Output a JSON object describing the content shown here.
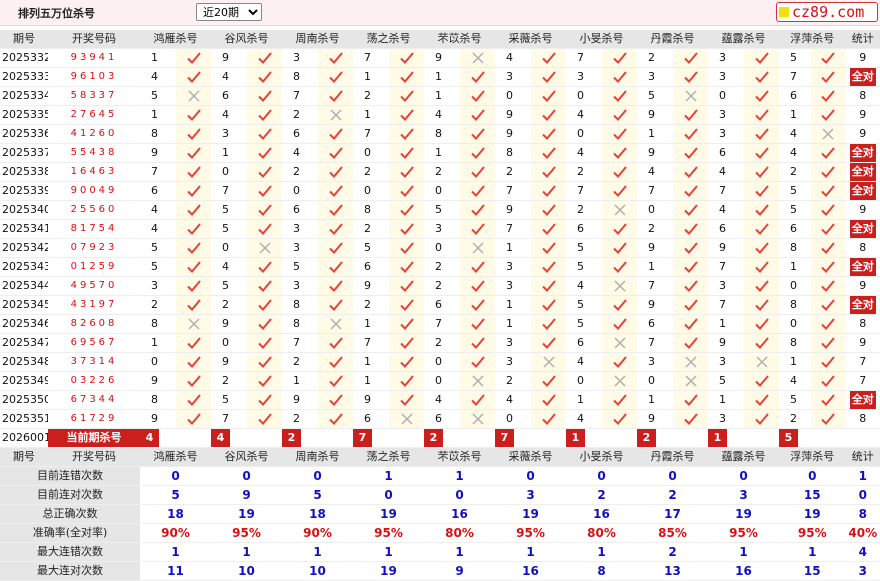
{
  "topbar": {
    "title": "排列五万位杀号",
    "period_options": [
      "近20期"
    ],
    "selected": "近20期",
    "logo": "cz89.com"
  },
  "headers": [
    "期号",
    "开奖号码",
    "鸿雁杀号",
    "谷风杀号",
    "周南杀号",
    "荡之杀号",
    "芣苡杀号",
    "采薇杀号",
    "小旻杀号",
    "丹霞杀号",
    "蕴露杀号",
    "浮萍杀号",
    "统计"
  ],
  "rows": [
    {
      "period": "2025332",
      "draw": "93941",
      "kills": [
        1,
        9,
        3,
        7,
        9,
        4,
        7,
        2,
        3,
        5
      ],
      "ok": [
        1,
        1,
        1,
        1,
        0,
        1,
        1,
        1,
        1,
        1
      ],
      "stat": "9"
    },
    {
      "period": "2025333",
      "draw": "96103",
      "kills": [
        4,
        4,
        8,
        1,
        1,
        3,
        3,
        3,
        3,
        7
      ],
      "ok": [
        1,
        1,
        1,
        1,
        1,
        1,
        1,
        1,
        1,
        1
      ],
      "stat": "全对"
    },
    {
      "period": "2025334",
      "draw": "58337",
      "kills": [
        5,
        6,
        7,
        2,
        1,
        0,
        0,
        5,
        0,
        6
      ],
      "ok": [
        0,
        1,
        1,
        1,
        1,
        1,
        1,
        0,
        1,
        1
      ],
      "stat": "8"
    },
    {
      "period": "2025335",
      "draw": "27645",
      "kills": [
        1,
        4,
        2,
        1,
        4,
        9,
        4,
        9,
        3,
        1
      ],
      "ok": [
        1,
        1,
        0,
        1,
        1,
        1,
        1,
        1,
        1,
        1
      ],
      "stat": "9"
    },
    {
      "period": "2025336",
      "draw": "41260",
      "kills": [
        8,
        3,
        6,
        7,
        8,
        9,
        0,
        1,
        3,
        4
      ],
      "ok": [
        1,
        1,
        1,
        1,
        1,
        1,
        1,
        1,
        1,
        0
      ],
      "stat": "9"
    },
    {
      "period": "2025337",
      "draw": "55438",
      "kills": [
        9,
        1,
        4,
        0,
        1,
        8,
        4,
        9,
        6,
        4
      ],
      "ok": [
        1,
        1,
        1,
        1,
        1,
        1,
        1,
        1,
        1,
        1
      ],
      "stat": "全对"
    },
    {
      "period": "2025338",
      "draw": "16463",
      "kills": [
        7,
        0,
        2,
        2,
        2,
        2,
        2,
        4,
        4,
        2
      ],
      "ok": [
        1,
        1,
        1,
        1,
        1,
        1,
        1,
        1,
        1,
        1
      ],
      "stat": "全对"
    },
    {
      "period": "2025339",
      "draw": "90049",
      "kills": [
        6,
        7,
        0,
        0,
        0,
        7,
        7,
        7,
        7,
        5
      ],
      "ok": [
        1,
        1,
        1,
        1,
        1,
        1,
        1,
        1,
        1,
        1
      ],
      "stat": "全对"
    },
    {
      "period": "2025340",
      "draw": "25560",
      "kills": [
        4,
        5,
        6,
        8,
        5,
        9,
        2,
        0,
        4,
        5
      ],
      "ok": [
        1,
        1,
        1,
        1,
        1,
        1,
        0,
        1,
        1,
        1
      ],
      "stat": "9"
    },
    {
      "period": "2025341",
      "draw": "81754",
      "kills": [
        4,
        5,
        3,
        2,
        3,
        7,
        6,
        2,
        6,
        6
      ],
      "ok": [
        1,
        1,
        1,
        1,
        1,
        1,
        1,
        1,
        1,
        1
      ],
      "stat": "全对"
    },
    {
      "period": "2025342",
      "draw": "07923",
      "kills": [
        5,
        0,
        3,
        5,
        0,
        1,
        5,
        9,
        9,
        8
      ],
      "ok": [
        1,
        0,
        1,
        1,
        0,
        1,
        1,
        1,
        1,
        1
      ],
      "stat": "8"
    },
    {
      "period": "2025343",
      "draw": "01259",
      "kills": [
        5,
        4,
        5,
        6,
        2,
        3,
        5,
        1,
        7,
        1
      ],
      "ok": [
        1,
        1,
        1,
        1,
        1,
        1,
        1,
        1,
        1,
        1
      ],
      "stat": "全对"
    },
    {
      "period": "2025344",
      "draw": "49570",
      "kills": [
        3,
        5,
        3,
        9,
        2,
        3,
        4,
        7,
        3,
        0
      ],
      "ok": [
        1,
        1,
        1,
        1,
        1,
        1,
        0,
        1,
        1,
        1
      ],
      "stat": "9"
    },
    {
      "period": "2025345",
      "draw": "43197",
      "kills": [
        2,
        2,
        8,
        2,
        6,
        1,
        5,
        9,
        7,
        8
      ],
      "ok": [
        1,
        1,
        1,
        1,
        1,
        1,
        1,
        1,
        1,
        1
      ],
      "stat": "全对"
    },
    {
      "period": "2025346",
      "draw": "82608",
      "kills": [
        8,
        9,
        8,
        1,
        7,
        1,
        5,
        6,
        1,
        0
      ],
      "ok": [
        0,
        1,
        0,
        1,
        1,
        1,
        1,
        1,
        1,
        1
      ],
      "stat": "8"
    },
    {
      "period": "2025347",
      "draw": "69567",
      "kills": [
        1,
        0,
        7,
        7,
        2,
        3,
        6,
        7,
        9,
        8
      ],
      "ok": [
        1,
        1,
        1,
        1,
        1,
        1,
        0,
        1,
        1,
        1
      ],
      "stat": "9"
    },
    {
      "period": "2025348",
      "draw": "37314",
      "kills": [
        0,
        9,
        2,
        1,
        0,
        3,
        4,
        3,
        3,
        1
      ],
      "ok": [
        1,
        1,
        1,
        1,
        1,
        0,
        1,
        0,
        0,
        1
      ],
      "stat": "7"
    },
    {
      "period": "2025349",
      "draw": "03226",
      "kills": [
        9,
        2,
        1,
        1,
        0,
        2,
        0,
        0,
        5,
        4
      ],
      "ok": [
        1,
        1,
        1,
        1,
        0,
        1,
        0,
        0,
        1,
        1
      ],
      "stat": "7"
    },
    {
      "period": "2025350",
      "draw": "67344",
      "kills": [
        8,
        5,
        9,
        9,
        4,
        4,
        1,
        1,
        1,
        5
      ],
      "ok": [
        1,
        1,
        1,
        1,
        1,
        1,
        1,
        1,
        1,
        1
      ],
      "stat": "全对"
    },
    {
      "period": "2025351",
      "draw": "61729",
      "kills": [
        9,
        7,
        2,
        6,
        6,
        0,
        4,
        9,
        3,
        2
      ],
      "ok": [
        1,
        1,
        1,
        0,
        0,
        1,
        1,
        1,
        1,
        1
      ],
      "stat": "8"
    }
  ],
  "current": {
    "period": "2026001",
    "label": "当前期杀号",
    "kills": [
      "4",
      "4",
      "2",
      "7",
      "2",
      "7",
      "1",
      "2",
      "1",
      "5"
    ]
  },
  "stats": [
    {
      "label": "目前连错次数",
      "values": [
        "0",
        "0",
        "0",
        "1",
        "1",
        "0",
        "0",
        "0",
        "0",
        "0",
        "1"
      ]
    },
    {
      "label": "目前连对次数",
      "values": [
        "5",
        "9",
        "5",
        "0",
        "0",
        "3",
        "2",
        "2",
        "3",
        "15",
        "0"
      ]
    },
    {
      "label": "总正确次数",
      "values": [
        "18",
        "19",
        "18",
        "19",
        "16",
        "19",
        "16",
        "17",
        "19",
        "19",
        "8"
      ]
    },
    {
      "label": "准确率(全对率)",
      "values": [
        "90%",
        "95%",
        "90%",
        "95%",
        "80%",
        "95%",
        "80%",
        "85%",
        "95%",
        "95%",
        "40%"
      ]
    },
    {
      "label": "最大连错次数",
      "values": [
        "1",
        "1",
        "1",
        "1",
        "1",
        "1",
        "1",
        "2",
        "1",
        "1",
        "4"
      ]
    },
    {
      "label": "最大连对次数",
      "values": [
        "11",
        "10",
        "10",
        "19",
        "9",
        "16",
        "8",
        "13",
        "16",
        "15",
        "3"
      ]
    }
  ],
  "colors": {
    "accent": "#c9201e",
    "check": "#e8403a",
    "cross": "#b0b0b0",
    "highlight": "#fffbe6",
    "header": "#e6e6e6",
    "stat_blue": "#1010c0"
  }
}
